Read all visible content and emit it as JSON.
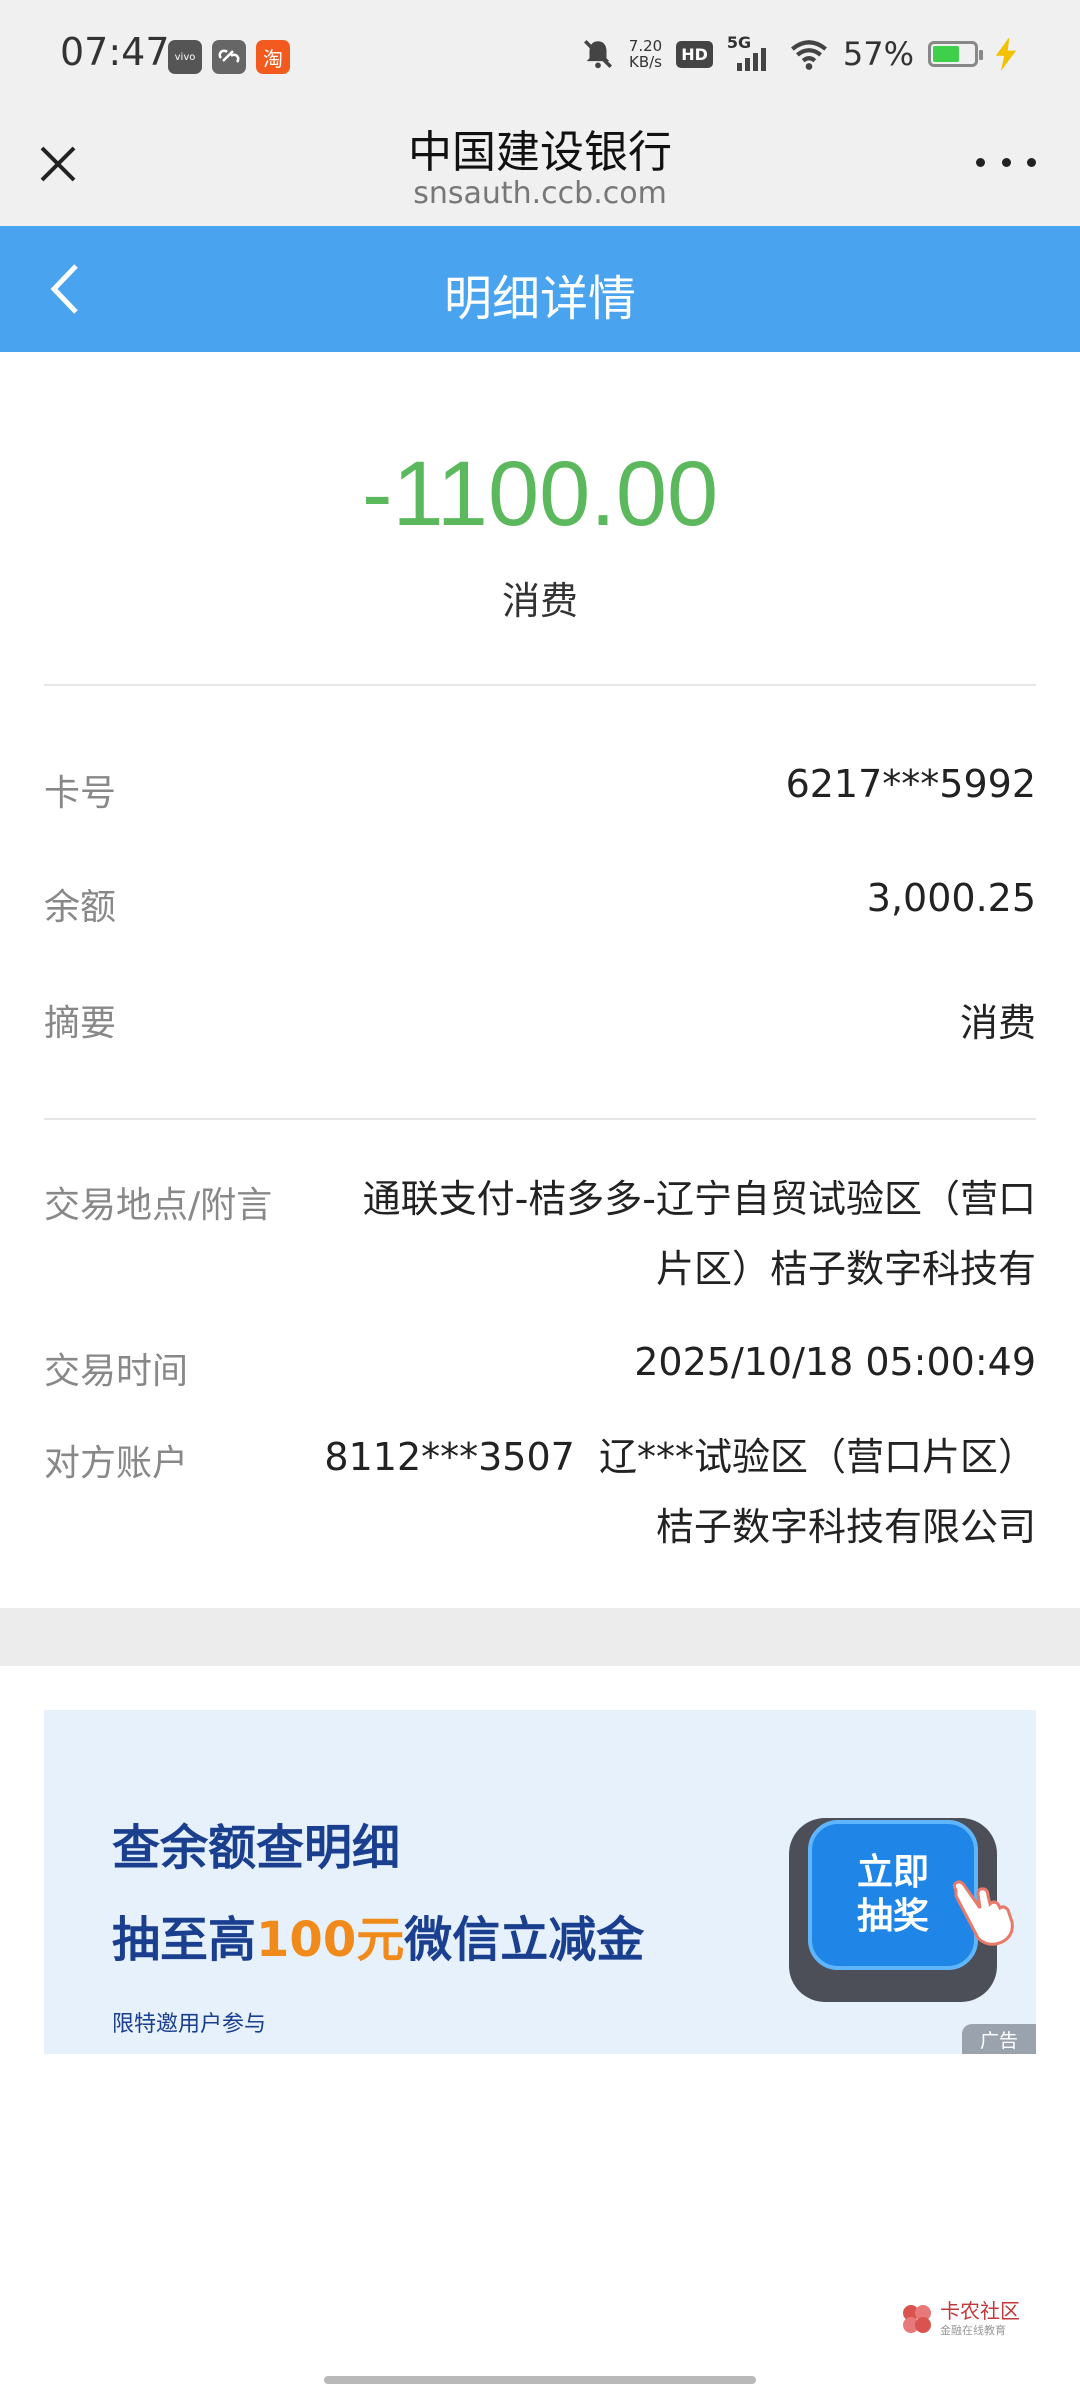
{
  "status_bar": {
    "time": "07:47",
    "net_speed_value": "7.20",
    "net_speed_unit": "KB/s",
    "hd": "HD",
    "signal": "5G",
    "battery_percent": "57%",
    "app_icons": [
      "vivo",
      "link",
      "淘"
    ]
  },
  "browser": {
    "title": "中国建设银行",
    "url": "snsauth.ccb.com"
  },
  "header": {
    "title": "明细详情"
  },
  "transaction": {
    "amount": "-1100.00",
    "type": "消费",
    "amount_color": "#5cb85c"
  },
  "details": {
    "card_label": "卡号",
    "card_value": "6217***5992",
    "balance_label": "余额",
    "balance_value": "3,000.25",
    "summary_label": "摘要",
    "summary_value": "消费",
    "location_label": "交易地点/附言",
    "location_line1": "通联支付-桔多多-辽宁自贸试验区（营口",
    "location_line2": "片区）桔子数字科技有",
    "time_label": "交易时间",
    "time_value": "2025/10/18 05:00:49",
    "counterparty_label": "对方账户",
    "counterparty_line1": "8112***3507  辽***试验区（营口片区）",
    "counterparty_line2": "桔子数字科技有限公司"
  },
  "ad": {
    "line1": "查余额查明细",
    "line2_prefix": "抽至高",
    "line2_highlight": "100元",
    "line2_suffix": "微信立减金",
    "note": "限特邀用户参与",
    "button_line1": "立即",
    "button_line2": "抽奖",
    "tag": "广告"
  },
  "watermark": {
    "name": "卡农社区",
    "sub": "金融在线教育"
  },
  "colors": {
    "header_bg": "#4aa3ee",
    "amount": "#5cb85c",
    "ad_text": "#1b3f8f",
    "ad_highlight": "#f08a1b"
  }
}
